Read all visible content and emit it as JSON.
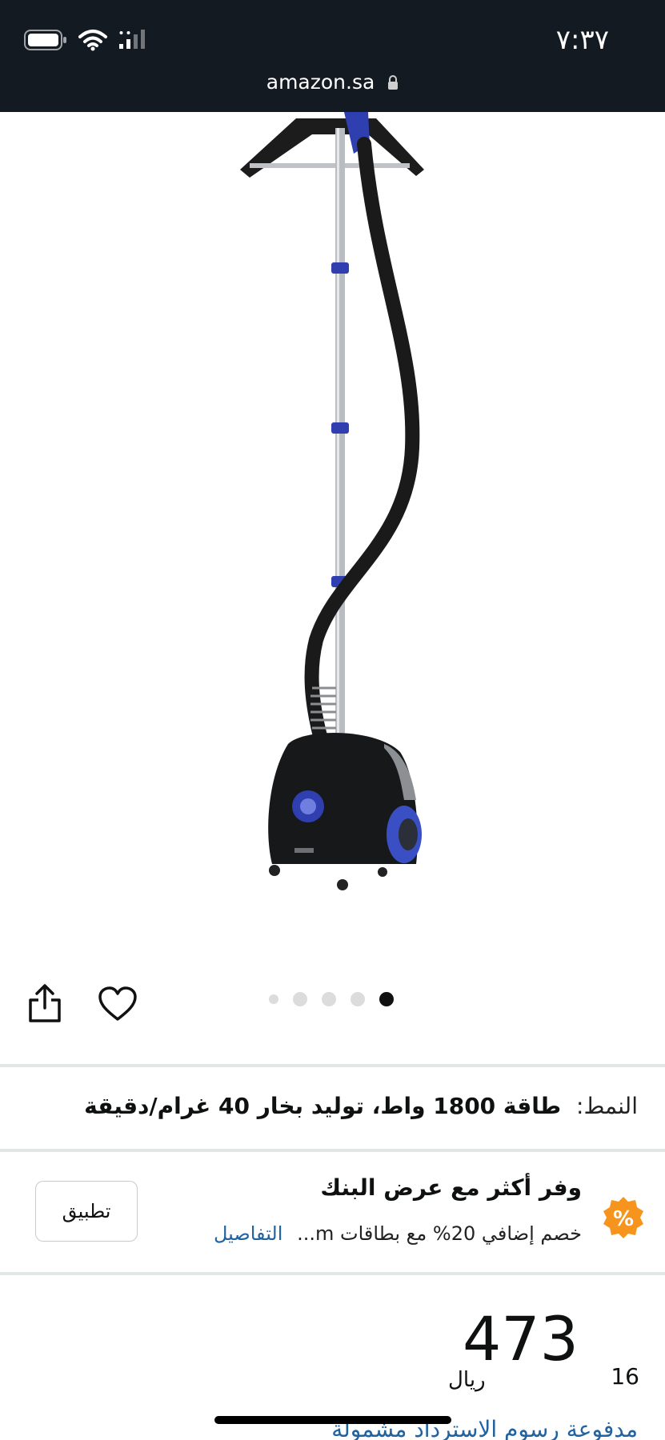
{
  "status_bar": {
    "time": "٧:٣٧"
  },
  "browser": {
    "url": "amazon.sa"
  },
  "carousel": {
    "image_count": 5,
    "active_index": 4
  },
  "style": {
    "label": "النمط:",
    "value": "طاقة 1800 واط، توليد بخار 40 غرام/دقيقة"
  },
  "offer": {
    "title": "وفر أكثر مع عرض البنك",
    "subtitle": "خصم إضافي 20% مع بطاقات m...",
    "details_link": "التفاصيل",
    "apply_button": "تطبيق",
    "badge_symbol": "%"
  },
  "price": {
    "whole": "473",
    "fraction": "16",
    "currency": "ريال"
  },
  "returns_text": "مدفوعة رسوم الاسترداد مشمولة",
  "colors": {
    "header_bg": "#141a22",
    "badge_orange": "#f7941d",
    "link_blue": "#2162a1",
    "accent_blue": "#2f3fb0"
  }
}
